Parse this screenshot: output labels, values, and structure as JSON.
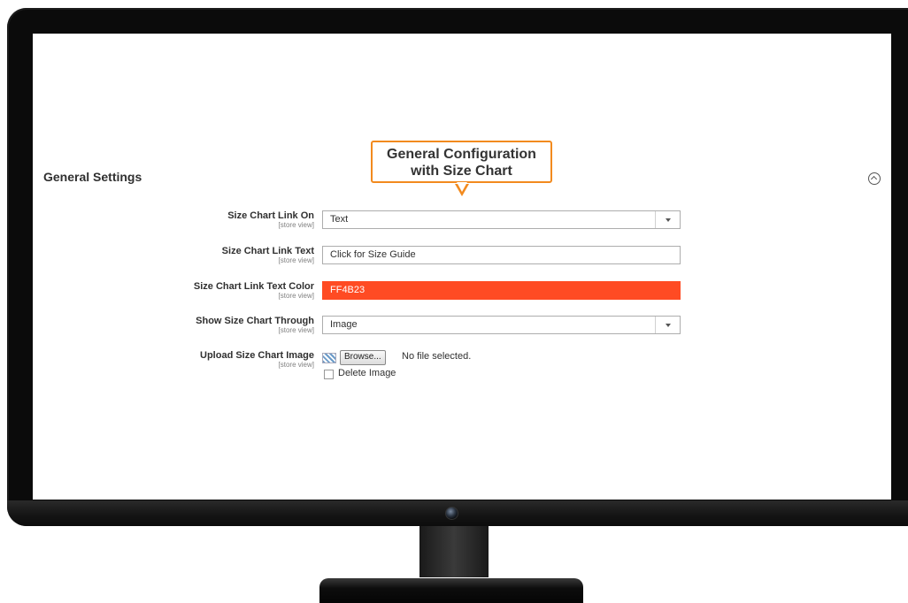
{
  "callout": {
    "line1": "General Configuration",
    "line2": "with Size Chart",
    "border_color": "#f28a1e"
  },
  "section": {
    "title": "General Settings",
    "toggle_icon": "chevron-up-circle-icon"
  },
  "fields": {
    "link_on": {
      "label": "Size Chart Link On",
      "scope": "[store view]",
      "value": "Text"
    },
    "link_text": {
      "label": "Size Chart Link Text",
      "scope": "[store view]",
      "value": "Click for Size Guide"
    },
    "link_color": {
      "label": "Size Chart Link Text Color",
      "scope": "[store view]",
      "value": "FF4B23",
      "swatch": "#ff4b23"
    },
    "show_through": {
      "label": "Show Size Chart Through",
      "scope": "[store view]",
      "value": "Image"
    },
    "upload": {
      "label": "Upload Size Chart Image",
      "scope": "[store view]",
      "browse_label": "Browse...",
      "file_status": "No file selected.",
      "delete_label": "Delete Image"
    }
  }
}
